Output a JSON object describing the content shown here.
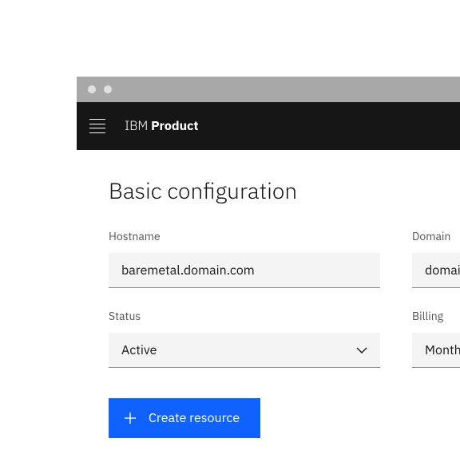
{
  "brand": {
    "light": "IBM ",
    "bold": "Product"
  },
  "page": {
    "title": "Basic configuration"
  },
  "form": {
    "hostname": {
      "label": "Hostname",
      "value": "baremetal.domain.com"
    },
    "domain": {
      "label": "Domain",
      "value": "domain.com"
    },
    "status": {
      "label": "Status",
      "value": "Active"
    },
    "billing": {
      "label": "Billing ",
      "value": "Monthly"
    }
  },
  "actions": {
    "create": "Create resource"
  },
  "colors": {
    "primary": "#0f62fe",
    "headerBg": "#161616",
    "fieldBg": "#f4f4f4"
  }
}
